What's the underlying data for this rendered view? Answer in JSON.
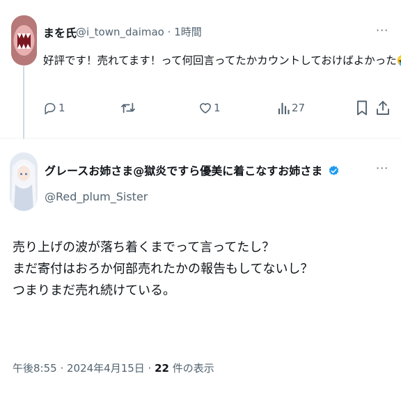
{
  "reply": {
    "display_name": "まを氏",
    "handle": "@i_town_daimao",
    "separator": "·",
    "time": "1時間",
    "text": "好評です！売れてます！って何回言ってたかカウントしておけばよかった",
    "emoji": "🤣",
    "more": "···",
    "actions": {
      "reply_count": "1",
      "retweet_count": "",
      "like_count": "1",
      "view_count": "27"
    },
    "icons": [
      "reply-icon",
      "retweet-icon",
      "like-icon",
      "views-icon",
      "bookmark-icon",
      "share-icon"
    ]
  },
  "main_post": {
    "display_name": "グレースお姉さま@獄炎ですら優美に着こなすお姉さま",
    "handle": "@Red_plum_Sister",
    "verified": true,
    "more": "···",
    "lines": [
      "売り上げの波が落ち着くまでって言ってたし？",
      "まだ寄付はおろか何部売れたかの報告もしてないし？",
      "つまりまだ売れ続けている。"
    ],
    "timestamp": "午後8:55 · 2024年4月15日 ·",
    "view_count": "22",
    "view_label": "件の表示"
  },
  "colors": {
    "text": "#0f1419",
    "secondary": "#536471",
    "verified": "#1d9bf0",
    "divider": "#eff3f4",
    "thread_line": "#cfd9de"
  }
}
